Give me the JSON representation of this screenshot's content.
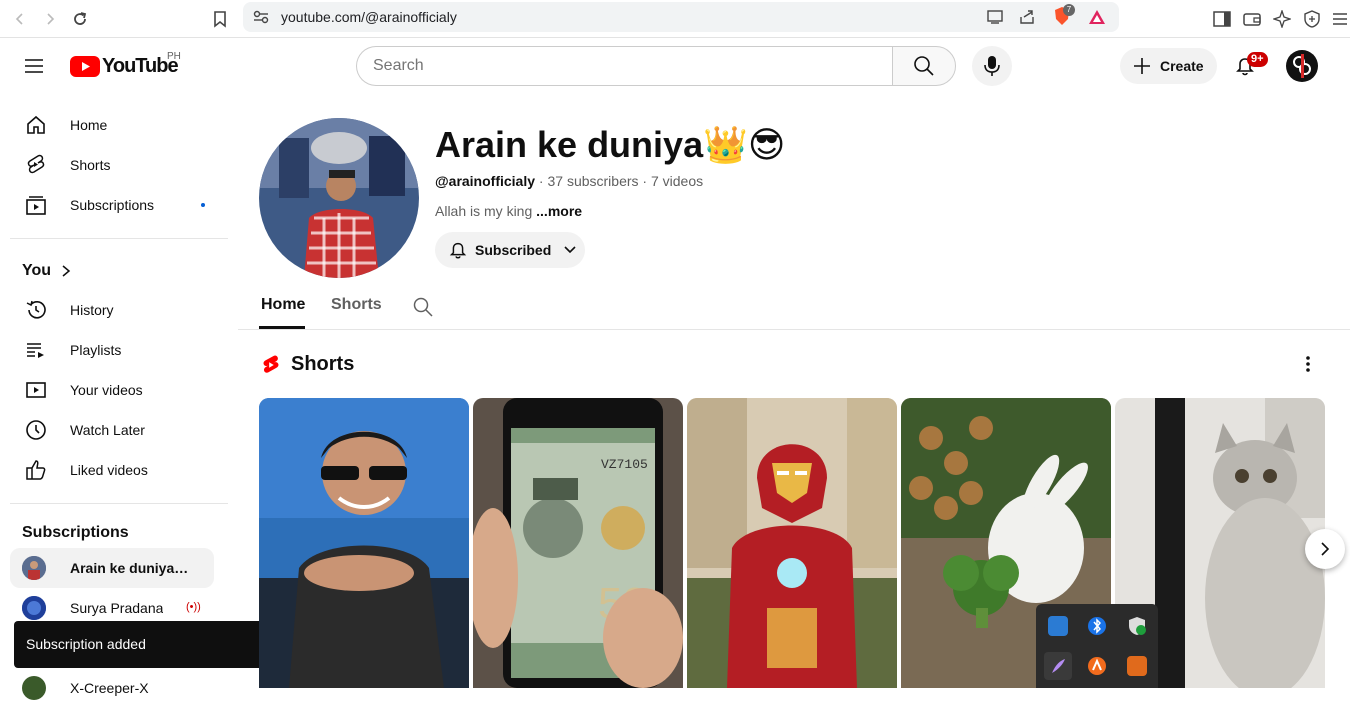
{
  "browser": {
    "url": "youtube.com/@arainofficialy",
    "extension_badge": "7"
  },
  "header": {
    "logo_text": "YouTube",
    "region": "PH",
    "search_placeholder": "Search",
    "create_label": "Create",
    "notifications_badge": "9+"
  },
  "sidebar": {
    "main": [
      {
        "label": "Home",
        "icon": "home-icon"
      },
      {
        "label": "Shorts",
        "icon": "shorts-icon"
      },
      {
        "label": "Subscriptions",
        "icon": "subscriptions-icon"
      }
    ],
    "you_heading": "You",
    "you_items": [
      {
        "label": "History",
        "icon": "history-icon"
      },
      {
        "label": "Playlists",
        "icon": "playlists-icon"
      },
      {
        "label": "Your videos",
        "icon": "your-videos-icon"
      },
      {
        "label": "Watch Later",
        "icon": "watch-later-icon"
      },
      {
        "label": "Liked videos",
        "icon": "liked-videos-icon"
      }
    ],
    "subscriptions_heading": "Subscriptions",
    "subscriptions": [
      {
        "label": "Arain ke duniya👑😎"
      },
      {
        "label": "Surya Pradana",
        "live": "(•))"
      },
      {
        "label": "X-Creeper-X"
      }
    ]
  },
  "toast": {
    "text": "Subscription added"
  },
  "channel": {
    "name": "Arain ke duniya👑😎",
    "handle": "@arainofficialy",
    "subscribers": "37 subscribers",
    "videos": "7 videos",
    "separator": "·",
    "description": "Allah is my king",
    "more_label": "...more",
    "subscribe_label": "Subscribed"
  },
  "tabs": [
    {
      "label": "Home",
      "active": true
    },
    {
      "label": "Shorts",
      "active": false
    }
  ],
  "shorts_section": {
    "title": "Shorts"
  },
  "colors": {
    "youtube_red": "#ff0000",
    "notification_red": "#cc0000",
    "text_primary": "#0f0f0f",
    "text_secondary": "#606060",
    "chip_bg": "#f2f2f2"
  }
}
